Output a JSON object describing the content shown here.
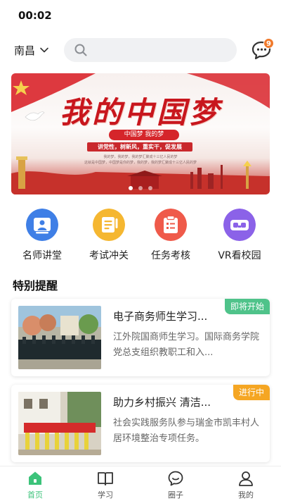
{
  "status_bar": {
    "time": "00:02"
  },
  "header": {
    "city": "南昌",
    "search": {
      "placeholder": "",
      "value": ""
    },
    "messages": {
      "badge_count": "9",
      "icon": "chat-bubble-icon"
    }
  },
  "banner": {
    "title": "我的中国梦",
    "subtitle": "中国梦 我的梦",
    "slogan": "讲党性，树新风，重实干，促发展",
    "small_text_1": "我的梦，我的梦，我的梦汇聚成十三亿人民的梦",
    "small_text_2": "这就是中国梦，中国梦是你的梦，我的梦，我的梦汇聚成十三亿人民的梦",
    "active_slide": 1,
    "slide_count": 3
  },
  "quick_entries": [
    {
      "label": "名师讲堂",
      "icon": "teacher-icon",
      "color": "#3f7fe6"
    },
    {
      "label": "考试冲关",
      "icon": "exam-icon",
      "color": "#f5b731"
    },
    {
      "label": "任务考核",
      "icon": "task-clipboard-icon",
      "color": "#ef5a4a"
    },
    {
      "label": "VR看校园",
      "icon": "vr-headset-icon",
      "color": "#8b62e8"
    }
  ],
  "section": {
    "title": "特别提醒"
  },
  "cards": [
    {
      "title": "电子商务师生学习...",
      "description": "江外院国商师生学习。国际商务学院党总支组织教职工和入...",
      "badge": "即将开始",
      "badge_color": "#4fc38a"
    },
    {
      "title": "助力乡村振兴 清洁...",
      "description": "社会实践服务队参与瑞金市凯丰村人居环境整治专项任务。",
      "badge": "进行中",
      "badge_color": "#f5a623"
    }
  ],
  "tab_bar": {
    "active_color": "#3cc37a",
    "tabs": [
      {
        "label": "首页",
        "icon": "home-icon",
        "active": true
      },
      {
        "label": "学习",
        "icon": "book-icon",
        "active": false
      },
      {
        "label": "圈子",
        "icon": "chat-circle-icon",
        "active": false
      },
      {
        "label": "我的",
        "icon": "person-icon",
        "active": false
      }
    ]
  }
}
